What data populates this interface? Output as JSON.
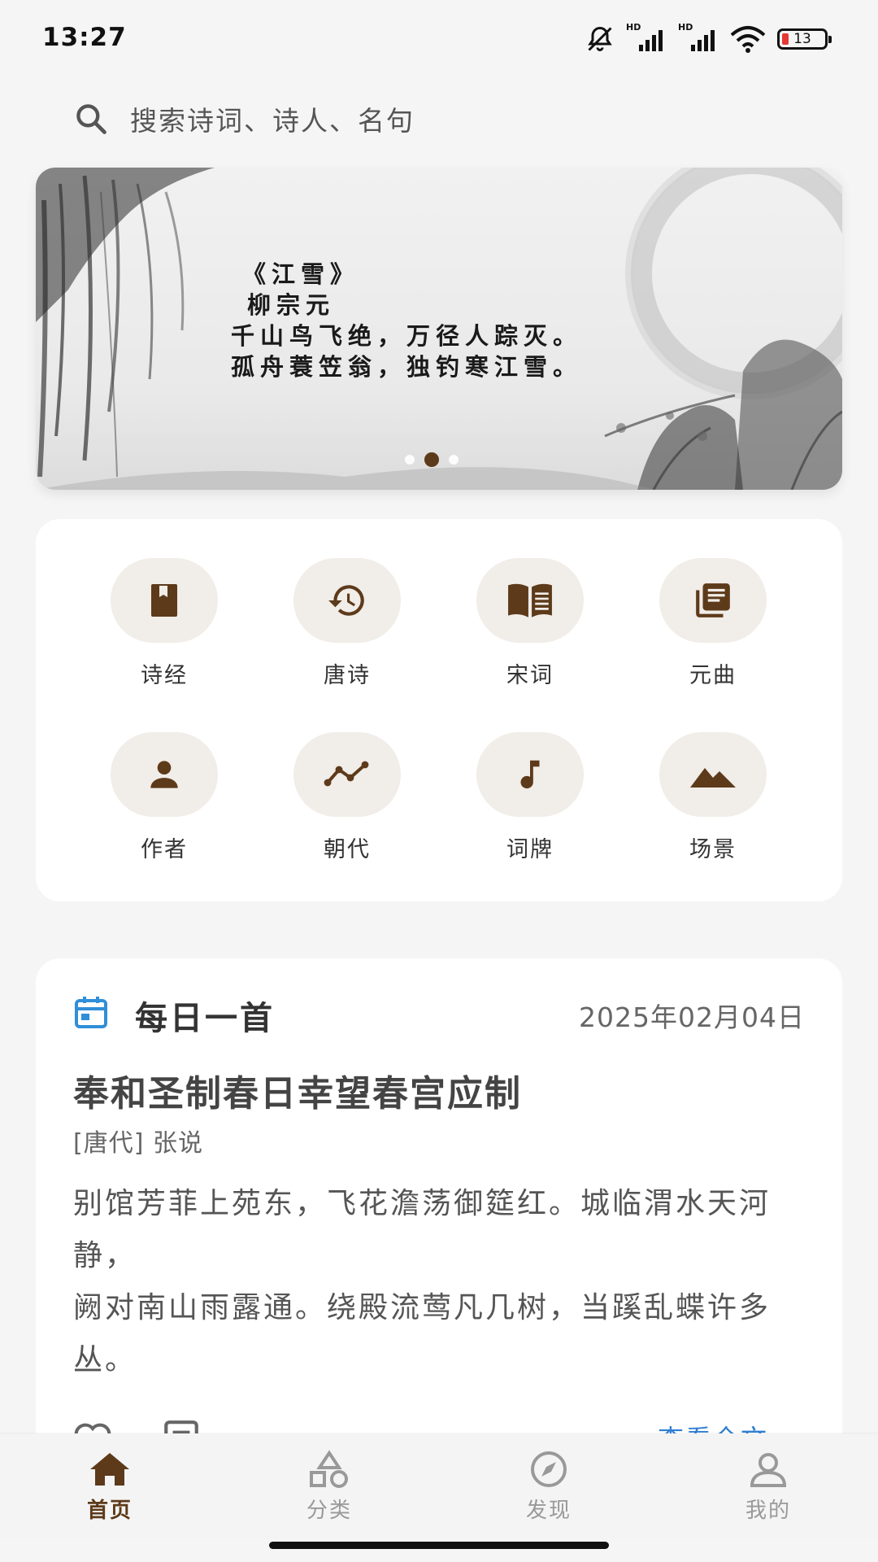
{
  "status_bar": {
    "time": "13:27",
    "battery": "13"
  },
  "search": {
    "placeholder": "搜索诗词、诗人、名句"
  },
  "banner": {
    "poem_lines": [
      "《江雪》",
      "柳宗元",
      "千山鸟飞绝，万径人踪灭。",
      "孤舟蓑笠翁，独钓寒江雪。"
    ],
    "page_count": 3,
    "active_page": 2
  },
  "categories": [
    {
      "label": "诗经",
      "icon": "book-icon"
    },
    {
      "label": "唐诗",
      "icon": "history-icon"
    },
    {
      "label": "宋词",
      "icon": "open-book-icon"
    },
    {
      "label": "元曲",
      "icon": "library-icon"
    },
    {
      "label": "作者",
      "icon": "person-icon"
    },
    {
      "label": "朝代",
      "icon": "timeline-icon"
    },
    {
      "label": "词牌",
      "icon": "music-note-icon"
    },
    {
      "label": "场景",
      "icon": "landscape-icon"
    }
  ],
  "daily": {
    "title": "每日一首",
    "date": "2025年02月04日",
    "poem_title": "奉和圣制春日幸望春宫应制",
    "author": "[唐代] 张说",
    "body_lines": [
      "别馆芳菲上苑东，飞花澹荡御筵红。城临渭水天河静，",
      "阙对南山雨露通。绕殿流莺凡几树，当蹊乱蝶许多丛。"
    ],
    "view_full": "查看全文"
  },
  "nav": [
    {
      "label": "首页",
      "icon": "home-icon",
      "active": true
    },
    {
      "label": "分类",
      "icon": "category-icon",
      "active": false
    },
    {
      "label": "发现",
      "icon": "compass-icon",
      "active": false
    },
    {
      "label": "我的",
      "icon": "profile-icon",
      "active": false
    }
  ],
  "colors": {
    "accent": "#5d3a1a",
    "link": "#2f7fd1",
    "calendar": "#2f8fd8",
    "chip": "#f1ede8"
  }
}
